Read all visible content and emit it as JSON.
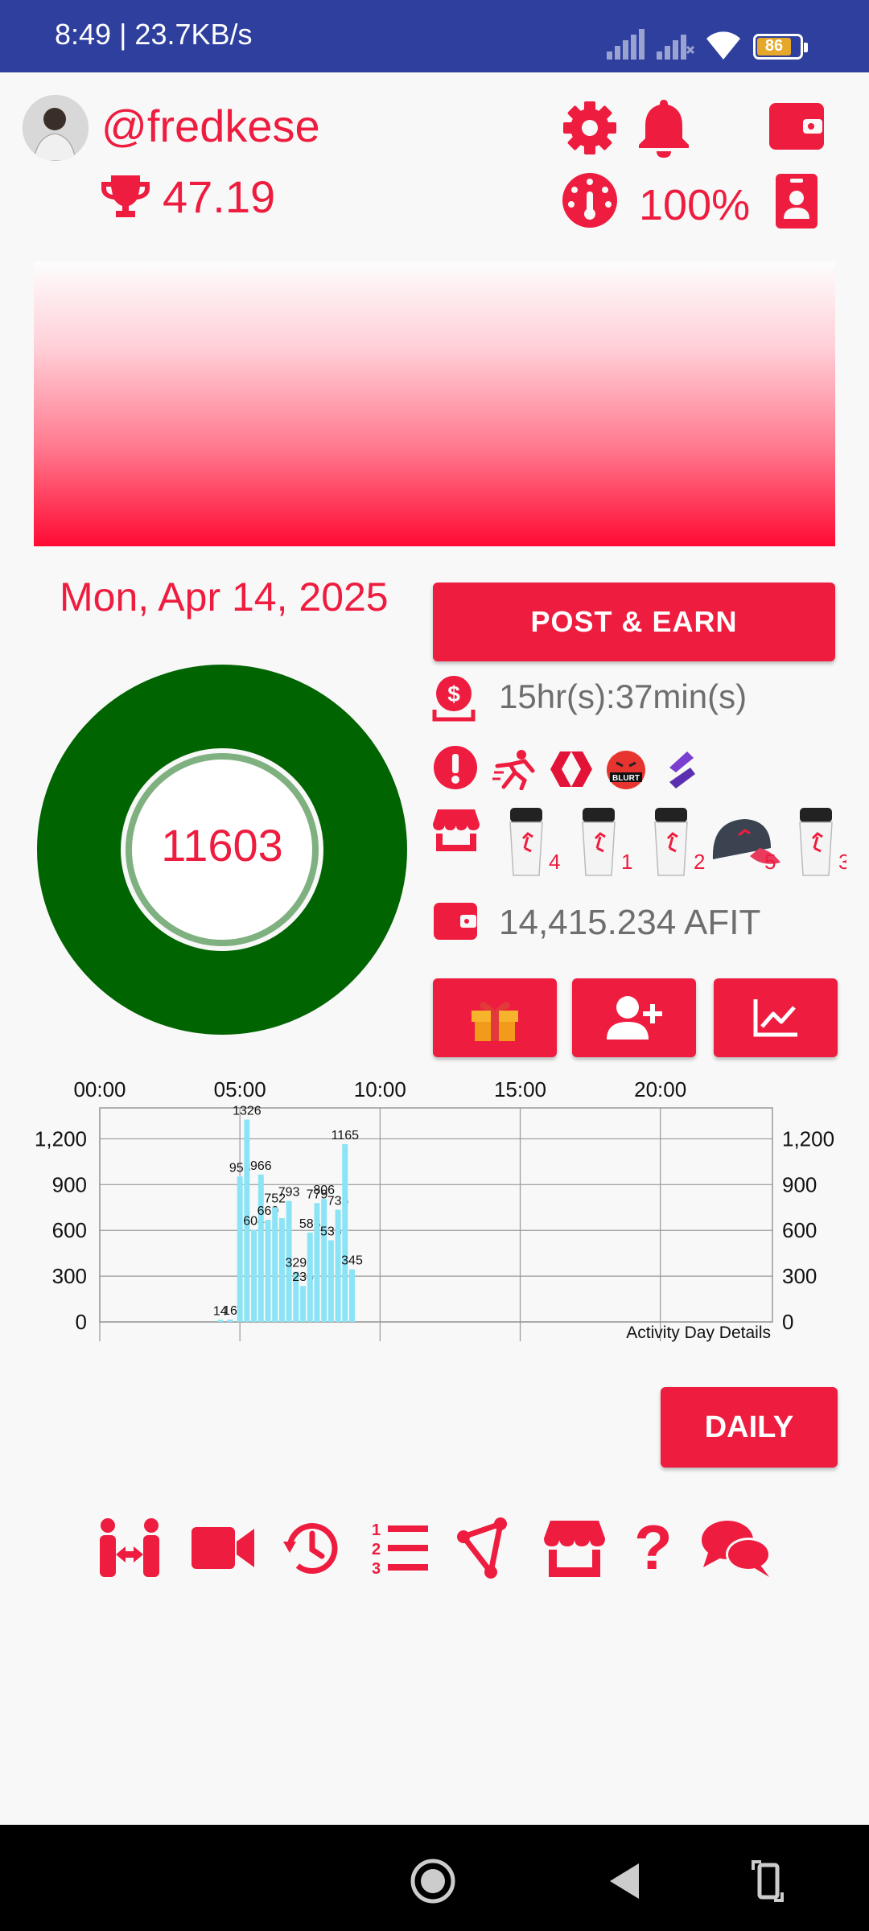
{
  "status_bar": {
    "time_speed": "8:49 | 23.7KB/s",
    "battery": "86"
  },
  "profile": {
    "username": "@fredkese",
    "score": "47.19",
    "power": "100%"
  },
  "date": "Mon, Apr 14, 2025",
  "actions": {
    "post_earn": "POST & EARN",
    "daily": "DAILY"
  },
  "countdown": "15hr(s):37min(s)",
  "steps": "11603",
  "balance": "14,415.234 AFIT",
  "products": [
    {
      "icon": "shaker-icon",
      "count": "4"
    },
    {
      "icon": "shaker-icon",
      "count": "1"
    },
    {
      "icon": "shaker-icon",
      "count": "2"
    },
    {
      "icon": "cap-icon",
      "count": "5"
    },
    {
      "icon": "shaker-icon",
      "count": "3"
    }
  ],
  "colors": {
    "accent": "#ee1c3f",
    "status_bar": "#2f3f9e",
    "donut": "#006400",
    "bars": "#8ae4f6"
  },
  "chart_data": {
    "type": "bar",
    "title": "",
    "annotation": "Activity Day Details",
    "x_ticks": [
      "00:00",
      "05:00",
      "10:00",
      "15:00",
      "20:00"
    ],
    "y_ticks": [
      "0",
      "300",
      "600",
      "900",
      "1,200"
    ],
    "ylim": [
      0,
      1350
    ],
    "xlim_hours": [
      0,
      24
    ],
    "grid": true,
    "bars": [
      {
        "hour": 4.3,
        "value": 14,
        "label": "14"
      },
      {
        "hour": 4.65,
        "value": 16,
        "label": "16"
      },
      {
        "hour": 5.0,
        "value": 953,
        "label": "953"
      },
      {
        "hour": 5.25,
        "value": 1326,
        "label": "1326"
      },
      {
        "hour": 5.5,
        "value": 604,
        "label": "604"
      },
      {
        "hour": 5.75,
        "value": 966,
        "label": "966"
      },
      {
        "hour": 6.0,
        "value": 669,
        "label": "669"
      },
      {
        "hour": 6.25,
        "value": 752,
        "label": "752"
      },
      {
        "hour": 6.5,
        "value": 680,
        "label": ""
      },
      {
        "hour": 6.75,
        "value": 793,
        "label": "793"
      },
      {
        "hour": 7.0,
        "value": 329,
        "label": "329"
      },
      {
        "hour": 7.25,
        "value": 236,
        "label": "236"
      },
      {
        "hour": 7.5,
        "value": 586,
        "label": "586"
      },
      {
        "hour": 7.75,
        "value": 779,
        "label": "779"
      },
      {
        "hour": 8.0,
        "value": 806,
        "label": "806"
      },
      {
        "hour": 8.25,
        "value": 535,
        "label": "535"
      },
      {
        "hour": 8.5,
        "value": 735,
        "label": "735"
      },
      {
        "hour": 8.75,
        "value": 1165,
        "label": "1165"
      },
      {
        "hour": 9.0,
        "value": 345,
        "label": "345"
      }
    ]
  }
}
